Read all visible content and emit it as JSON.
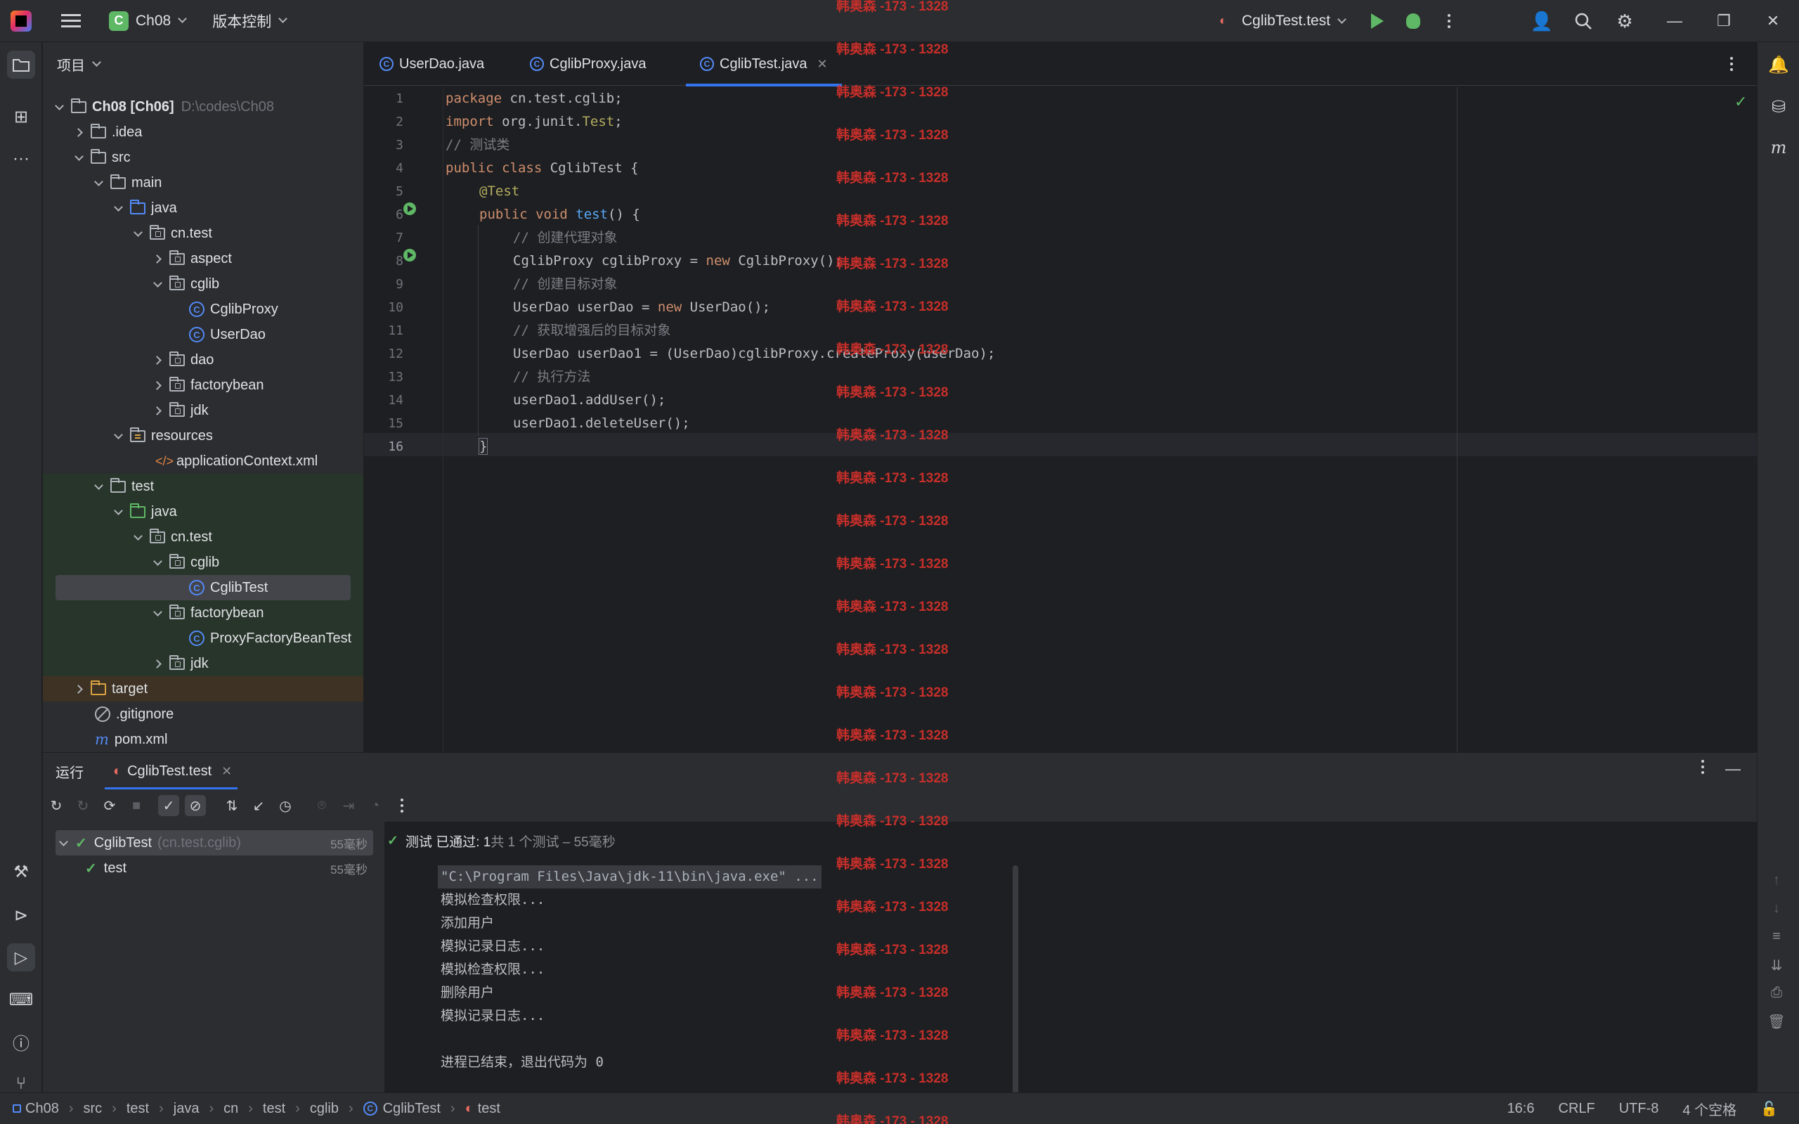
{
  "titlebar": {
    "project_badge": "C",
    "project_name": "Ch08",
    "vcs_label": "版本控制",
    "run_config": "CglibTest.test"
  },
  "project_panel": {
    "header": "项目",
    "tree": [
      {
        "label": "Ch08 [Ch06]",
        "suffix": "D:\\codes\\Ch08",
        "bold": true
      },
      {
        "label": ".idea"
      },
      {
        "label": "src"
      },
      {
        "label": "main"
      },
      {
        "label": "java"
      },
      {
        "label": "cn.test"
      },
      {
        "label": "aspect"
      },
      {
        "label": "cglib"
      },
      {
        "label": "CglibProxy"
      },
      {
        "label": "UserDao"
      },
      {
        "label": "dao"
      },
      {
        "label": "factorybean"
      },
      {
        "label": "jdk"
      },
      {
        "label": "resources"
      },
      {
        "label": "applicationContext.xml"
      },
      {
        "label": "test"
      },
      {
        "label": "java"
      },
      {
        "label": "cn.test"
      },
      {
        "label": "cglib"
      },
      {
        "label": "CglibTest"
      },
      {
        "label": "factorybean"
      },
      {
        "label": "ProxyFactoryBeanTest"
      },
      {
        "label": "jdk"
      },
      {
        "label": "target"
      },
      {
        "label": ".gitignore"
      },
      {
        "label": "pom.xml"
      }
    ]
  },
  "editor": {
    "tabs": [
      {
        "label": "UserDao.java"
      },
      {
        "label": "CglibProxy.java"
      },
      {
        "label": "CglibTest.java",
        "active": true
      }
    ],
    "line_numbers": [
      "1",
      "2",
      "3",
      "4",
      "5",
      "6",
      "7",
      "8",
      "9",
      "10",
      "11",
      "12",
      "13",
      "14",
      "15",
      "16"
    ],
    "code": {
      "l1_kw": "package",
      "l1_rest": " cn.test.cglib;",
      "l2_kw": "import",
      "l2_a": " org.junit.",
      "l2_b": "Test",
      "l2_c": ";",
      "l3": "// 测试类",
      "l4_kw": "public class",
      "l4_rest": " CglibTest {",
      "l5": "@Test",
      "l6_kw": "public void",
      "l6_fn": " test",
      "l6_rest": "() {",
      "l7": "// 创建代理对象",
      "l8_a": "CglibProxy cglibProxy = ",
      "l8_kw": "new",
      "l8_b": " CglibProxy();",
      "l9": "// 创建目标对象",
      "l10_a": "UserDao userDao = ",
      "l10_kw": "new",
      "l10_b": " UserDao();",
      "l11": "// 获取增强后的目标对象",
      "l12": "UserDao userDao1 = (UserDao)cglibProxy.createProxy(userDao);",
      "l13": "// 执行方法",
      "l14": "userDao1.addUser();",
      "l15": "userDao1.deleteUser();",
      "l16": "}"
    }
  },
  "run_panel": {
    "title": "运行",
    "tab_label": "CglibTest.test",
    "status_prefix": "测试 已通过: 1",
    "status_suffix": "共 1 个测试 – 55毫秒",
    "tests": [
      {
        "name": "CglibTest",
        "pkg": "(cn.test.cglib)",
        "duration": "55毫秒"
      },
      {
        "name": "test",
        "duration": "55毫秒"
      }
    ],
    "console": [
      "\"C:\\Program Files\\Java\\jdk-11\\bin\\java.exe\" ...",
      "模拟检查权限...",
      "添加用户",
      "模拟记录日志...",
      "模拟检查权限...",
      "删除用户",
      "模拟记录日志...",
      "",
      "进程已结束，退出代码为 0"
    ]
  },
  "statusbar": {
    "breadcrumb": [
      "Ch08",
      "src",
      "test",
      "java",
      "cn",
      "test",
      "cglib",
      "CglibTest",
      "test"
    ],
    "position": "16:6",
    "line_sep": "CRLF",
    "encoding": "UTF-8",
    "indent": "4 个空格"
  },
  "watermark": "韩奥森 -173 - 1328",
  "colors": {
    "accent": "#3574f0",
    "success": "#5fb865",
    "watermark": "#d0302b"
  }
}
